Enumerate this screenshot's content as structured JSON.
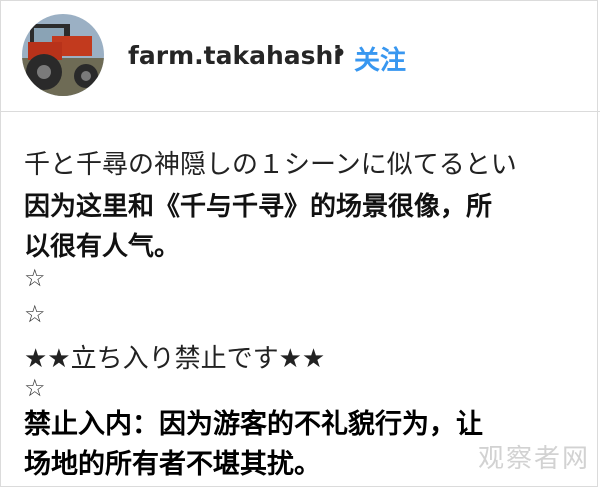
{
  "header": {
    "username": "farm.takahashi",
    "separator": "•",
    "follow_label": "关注"
  },
  "caption": {
    "lines": [
      "千と千尋の神隠しの１シーンに似てるとい",
      "因为这里和《千与千寻》的场景很像，所",
      "以很有人气。",
      "☆",
      "☆",
      "★★立ち入り禁止です★★",
      "☆",
      "禁止入内：因为游客的不礼貌行为，让",
      "场地的所有者不堪其扰。"
    ]
  },
  "watermark": "观察者网",
  "colors": {
    "follow": "#3897f0",
    "border": "#dbdbdb"
  }
}
